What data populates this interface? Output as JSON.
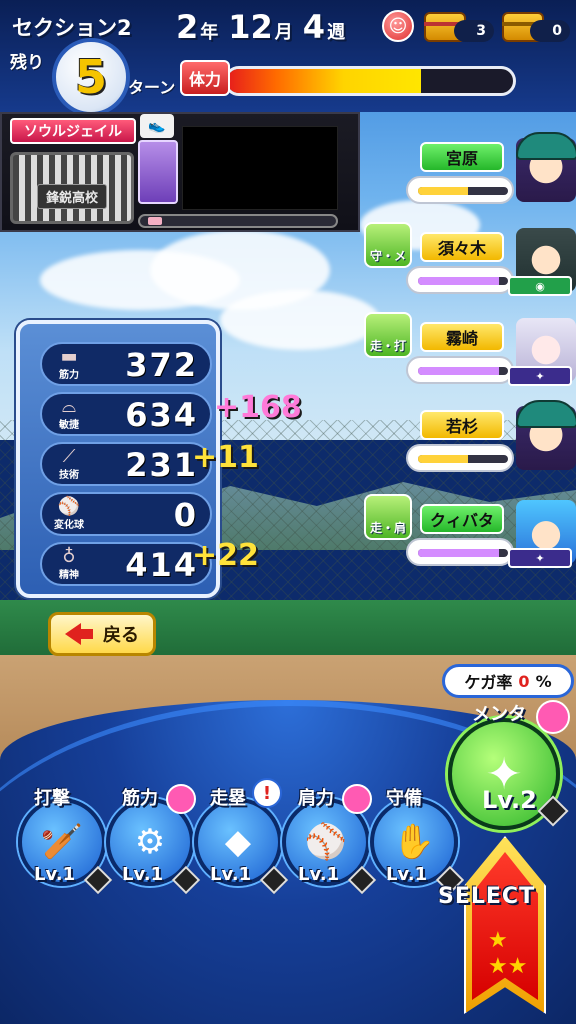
{
  "header": {
    "section": "セクション2",
    "remaining_label": "残り",
    "turns_left": "5",
    "turn_label": "ターン",
    "date": {
      "year": "2",
      "year_unit": "年",
      "month": "12",
      "month_unit": "月",
      "week": "4",
      "week_unit": "週"
    },
    "mood_icon": "smile-face-icon",
    "chest_red_count": "3",
    "chest_gold_count": "0",
    "stamina_label": "体力",
    "stamina_fraction": 0.68
  },
  "school": {
    "name": "ソウルジェイル",
    "emblem_text": "鋒鋭高校"
  },
  "stats": [
    {
      "icon": "barbell-icon",
      "label": "筋力",
      "value": "372",
      "bonus": ""
    },
    {
      "icon": "shoe-icon",
      "label": "敏捷",
      "value": "634",
      "bonus": "+168",
      "bonus_color": "#ff7ad8"
    },
    {
      "icon": "bat-icon",
      "label": "技術",
      "value": "231",
      "bonus": "+11",
      "bonus_color": "#ffe23a"
    },
    {
      "icon": "ball-icon",
      "label": "変化球",
      "value": "0",
      "bonus": ""
    },
    {
      "icon": "spirit-icon",
      "label": "精神",
      "value": "414",
      "bonus": "+22",
      "bonus_color": "#ffe23a"
    }
  ],
  "back_button": "戻る",
  "teammates": [
    {
      "name": "宮原",
      "name_color": "green",
      "hint": "",
      "tag": "",
      "bar_color": "#ffd23a",
      "bar_fraction": 0.55
    },
    {
      "name": "須々木",
      "name_color": "yellow",
      "hint": "守・メ",
      "tag": "",
      "tag_color": "green",
      "bar_color": "#d48cff",
      "bar_fraction": 0.9
    },
    {
      "name": "霧崎",
      "name_color": "yellow",
      "hint": "走・打",
      "tag": "",
      "bar_color": "#d48cff",
      "bar_fraction": 0.9
    },
    {
      "name": "若杉",
      "name_color": "yellow",
      "hint": "",
      "tag": "",
      "bar_color": "#ffd23a",
      "bar_fraction": 0.55
    },
    {
      "name": "クィバタ",
      "name_color": "green",
      "hint": "走・肩",
      "tag": "",
      "bar_color": "#d48cff",
      "bar_fraction": 0.9
    }
  ],
  "injury": {
    "label": "ケガ率",
    "value": "0",
    "unit": "%"
  },
  "training": [
    {
      "name": "打撃",
      "level": "Lv.1",
      "icon": "bat-icon"
    },
    {
      "name": "筋力",
      "level": "Lv.1",
      "icon": "dumbbell-icon"
    },
    {
      "name": "走塁",
      "level": "Lv.1",
      "icon": "base-icon"
    },
    {
      "name": "肩力",
      "level": "Lv.1",
      "icon": "fire-ball-icon"
    },
    {
      "name": "守備",
      "level": "Lv.1",
      "icon": "glove-icon"
    }
  ],
  "mental": {
    "name": "メンタ",
    "level": "Lv.2"
  },
  "select_label": "SELECT"
}
